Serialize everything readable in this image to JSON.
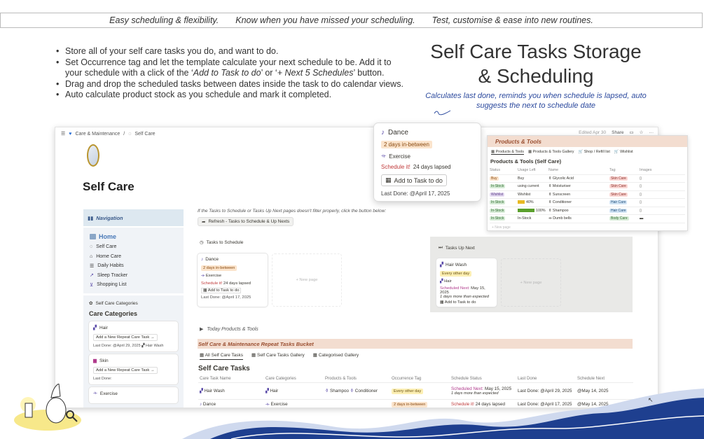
{
  "banner": {
    "items": [
      "Easy scheduling & flexibility.",
      "Know when you have missed your scheduling.",
      "Test, customise & ease into new routines."
    ]
  },
  "bullets": {
    "b1": "Store all of your self care tasks you do, and want to do.",
    "b2_start": "Set Occurrence tag and let the template calculate your next schedule to be. Add it to your schedule with a click of the ‘",
    "b2_em1": "Add to Task to do",
    "b2_mid": "’ or ‘",
    "b2_em2": "+ Next 5 Schedules",
    "b2_end": "’ button.",
    "b3": "Drag and drop the scheduled tasks between dates inside the task to do calendar views.",
    "b4": "Auto calculate product stock as you schedule and mark it completed."
  },
  "hero": {
    "title_line1": "Self Care Tasks Storage",
    "title_line2": "& Scheduling",
    "subtitle": "Calculates last done, reminds you when schedule is lapsed, auto suggests the next to schedule date"
  },
  "app": {
    "breadcrumb": [
      "Care & Maintenance",
      "Self Care"
    ],
    "edited": "Edited Apr 30",
    "share": "Share",
    "page_title": "Self Care",
    "navigation_label": "Navigation",
    "nav_home": "Home",
    "nav_items": [
      "Self Care",
      "Home Care",
      "Daily Habits",
      "Sleep Tracker",
      "Shopping List"
    ],
    "categories_small": "Self Care Categories",
    "categories_big": "Care Categories",
    "cat_cards": [
      {
        "name": "Hair",
        "button": "Add a New Repeat Care Task →",
        "last_done": "Last Done: @April 29, 2025",
        "product": "Hair Wash"
      },
      {
        "name": "Skin",
        "button": "Add a New Repeat Care Task →",
        "last_done": "Last Done:"
      },
      {
        "name": "Exercise"
      }
    ],
    "notice": "If the Tasks to Schedule or Tasks Up Next pages doesn't filter properly, click the button below:",
    "refresh": "Refresh - Tasks to Schedule & Up Nexts",
    "tasks_to_schedule": "Tasks to Schedule",
    "tasks_up_next": "Tasks Up Next",
    "new_page": "+ New page",
    "dance_card": {
      "name": "Dance",
      "tag": "2 days in-between",
      "category": "Exercise",
      "status_label": "Schedule it!",
      "status_rest": "24 days lapsed",
      "button": "Add to Task to do",
      "last_done": "Last Done: @April 17, 2025"
    },
    "hairwash_card": {
      "name": "Hair Wash",
      "tag": "Every other day",
      "category": "Hair",
      "status_label": "Scheduled Next:",
      "status_rest": "May 15, 2025",
      "note": "1 days more than expected",
      "button": "Add to Task to do"
    },
    "today_products": "Today Products & Tools",
    "bucket": "Self Care & Maintenance Repeat Tasks Bucket",
    "view_tabs": [
      "All Self Care Tasks",
      "Self Care Tasks Gallery",
      "Categorised Gallery"
    ],
    "table_title": "Self Care Tasks",
    "table_headers": [
      "Care Task Name",
      "Care Categories",
      "Products & Tools",
      "Occurrence Tag",
      "Schedule Status",
      "Last Done",
      "Schedule Next"
    ],
    "rows": [
      {
        "name": "Hair Wash",
        "cat": "Hair",
        "products": [
          "Shampoo",
          "Conditioner"
        ],
        "tag": "Every other day",
        "status_label": "Scheduled Next:",
        "status_rest": "May 15, 2025",
        "status_note": "1 days more than expected",
        "last_done": "Last Done: @April 29, 2025",
        "next": "@May 14, 2025"
      },
      {
        "name": "Dance",
        "cat": "Exercise",
        "products": [],
        "tag": "2 days in-between",
        "status_label": "Schedule it!",
        "status_rest": "24 days lapsed",
        "last_done": "Last Done: @April 17, 2025",
        "next": "@May 14, 2025"
      }
    ]
  },
  "popup": {
    "name": "Dance",
    "tag": "2 days in-between",
    "category": "Exercise",
    "status_label": "Schedule it!",
    "status_rest": "24 days lapsed",
    "button": "Add to Task to do",
    "last_done": "Last Done: @April 17, 2025"
  },
  "products": {
    "header": "Products & Tools",
    "tabs": [
      "Products & Tools",
      "Products & Tools Gallery",
      "Shop / Refill list",
      "Wishlist"
    ],
    "title": "Products & Tools (Self Care)",
    "headers": [
      "Status",
      "Usage Left",
      "Name",
      "Tag",
      "Images"
    ],
    "rows": [
      {
        "status": "Buy",
        "usage": "Buy",
        "name": "Glycolic Acid",
        "tag": "Skin Care"
      },
      {
        "status": "In-Stock",
        "usage": "using current",
        "name": "Moisturiser",
        "tag": "Skin Care"
      },
      {
        "status": "Wishlist",
        "usage": "Wishlist",
        "name": "Sunscreen",
        "tag": "Skin Care"
      },
      {
        "status": "In-Stock",
        "usage": "40%",
        "usage_level": 0.4,
        "name": "Conditioner",
        "tag": "Hair Care"
      },
      {
        "status": "In-Stock",
        "usage": "100%",
        "usage_level": 1.0,
        "name": "Shampoo",
        "tag": "Hair Care"
      },
      {
        "status": "In-Stock",
        "usage": "In-Stock",
        "name": "Dumb bells",
        "tag": "Body Care"
      }
    ],
    "new_page": "+ New page"
  },
  "colors": {
    "accent_blue": "#2c4a9e",
    "bucket": "#f3ddd0",
    "wave": "#1e3f8f"
  }
}
